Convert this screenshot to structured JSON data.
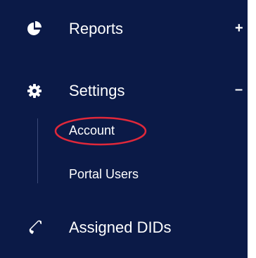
{
  "sidebar": {
    "items": [
      {
        "label": "Reports",
        "icon": "pie-chart-icon",
        "toggle": "+"
      },
      {
        "label": "Settings",
        "icon": "gear-icon",
        "toggle": "–"
      },
      {
        "label": "Assigned DIDs",
        "icon": "phone-icon"
      }
    ],
    "settings_sub": [
      {
        "label": "Account"
      },
      {
        "label": "Portal Users"
      }
    ]
  },
  "colors": {
    "sidebar_bg": "#0b1a47",
    "text": "#ffffff",
    "highlight": "#e0283a"
  }
}
